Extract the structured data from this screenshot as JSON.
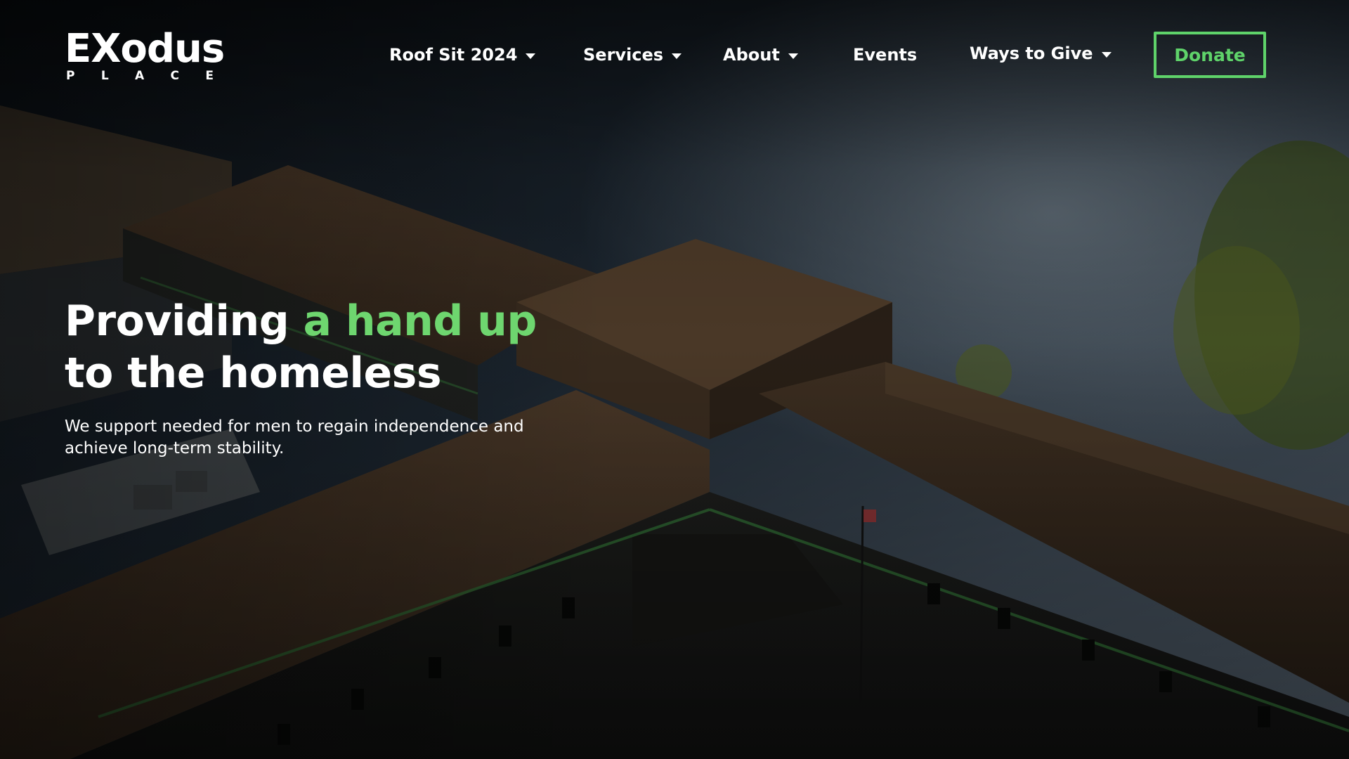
{
  "brand": {
    "logo_word": "EXodus",
    "logo_sub": [
      "P",
      "L",
      "A",
      "C",
      "E"
    ]
  },
  "nav": {
    "items": [
      {
        "label": "Roof Sit 2024",
        "has_dropdown": true
      },
      {
        "label": "Services",
        "has_dropdown": true
      },
      {
        "label": "About",
        "has_dropdown": true
      },
      {
        "label": "Events",
        "has_dropdown": false
      },
      {
        "label": "Ways to Give",
        "has_dropdown": true
      }
    ],
    "donate_label": "Donate"
  },
  "hero": {
    "title_prefix": "Providing",
    "title_accent": "a hand up",
    "title_line2": "to the homeless",
    "subtitle": "We support needed for men to regain independence and achieve long-term stability."
  },
  "colors": {
    "accent_green": "#6ed66f",
    "button_border": "#5fd36a",
    "text": "#ffffff"
  },
  "icons": [
    "chevron-down-icon",
    "person-x-logo-icon"
  ]
}
